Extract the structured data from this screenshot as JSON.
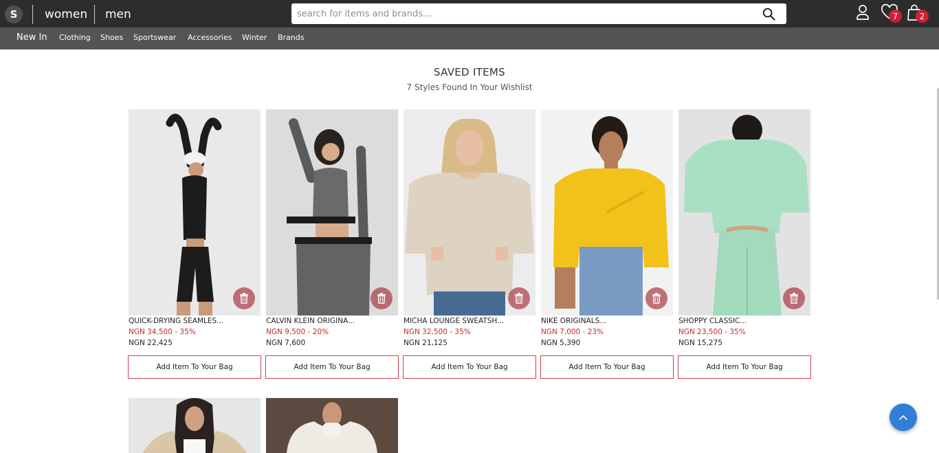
{
  "header": {
    "logo": "S",
    "genders": [
      "women",
      "men"
    ],
    "search_placeholder": "search for items and brands...",
    "wishlist_count": "7",
    "bag_count": "2"
  },
  "nav": [
    "New In",
    "Clothing",
    "Shoes",
    "Sportswear",
    "Accessories",
    "Winter",
    "Brands"
  ],
  "page": {
    "title": "SAVED ITEMS",
    "subtitle": "7 Styles Found In Your Wishlist"
  },
  "add_label": "Add Item To Your Bag",
  "products": [
    {
      "name": "QUICK-DRYING SEAMLES...",
      "old_price": "NGN 34,500 - 35%",
      "new_price": "NGN 22,425"
    },
    {
      "name": "CALVIN KLEIN ORIGINA...",
      "old_price": "NGN 9,500 - 20%",
      "new_price": "NGN 7,600"
    },
    {
      "name": "MICHA LOUNGE SWEATSH...",
      "old_price": "NGN 32,500 - 35%",
      "new_price": "NGN 21,125"
    },
    {
      "name": "NIKE ORIGINALS...",
      "old_price": "NGN 7,000 - 23%",
      "new_price": "NGN 5,390"
    },
    {
      "name": "SHOPPY CLASSIC...",
      "old_price": "NGN 23,500 - 35%",
      "new_price": "NGN 15,275"
    }
  ],
  "colors": {
    "topbar": "#2d2d2d",
    "navbar": "#545454",
    "accent": "#c9414b",
    "price_red": "#c22a2a",
    "badge": "#d0222e",
    "scroll_top": "#2f7fd9"
  }
}
